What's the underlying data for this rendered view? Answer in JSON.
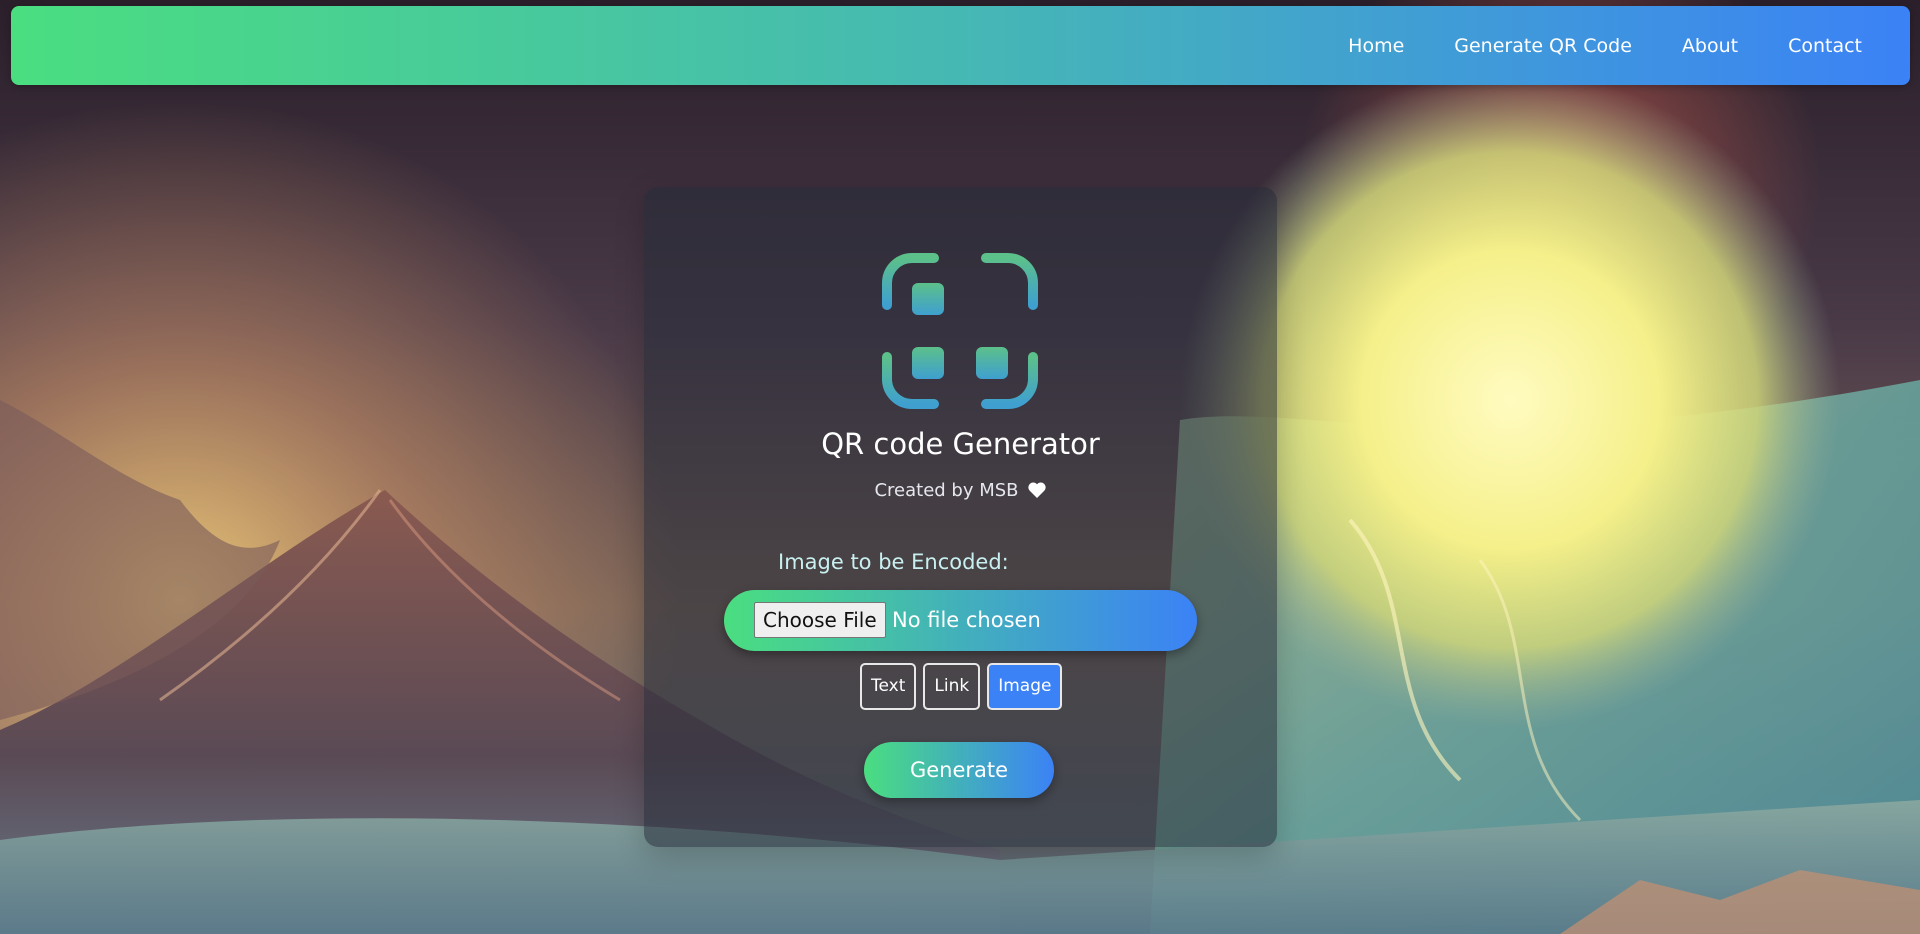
{
  "nav": {
    "links": [
      {
        "label": "Home"
      },
      {
        "label": "Generate QR Code"
      },
      {
        "label": "About"
      },
      {
        "label": "Contact"
      }
    ]
  },
  "card": {
    "logo_icon": "qr-scan-icon",
    "title": "QR code Generator",
    "subtitle": "Created by MSB",
    "subtitle_icon": "heart-icon",
    "field_label": "Image to be Encoded:",
    "file_input": {
      "button_label": "Choose File",
      "status": "No file chosen"
    },
    "type_buttons": [
      {
        "label": "Text",
        "active": false
      },
      {
        "label": "Link",
        "active": false
      },
      {
        "label": "Image",
        "active": true
      }
    ],
    "generate_label": "Generate"
  },
  "colors": {
    "gradient_start": "#4ade80",
    "gradient_end": "#3b82f6",
    "active_button": "#3b82f6"
  }
}
